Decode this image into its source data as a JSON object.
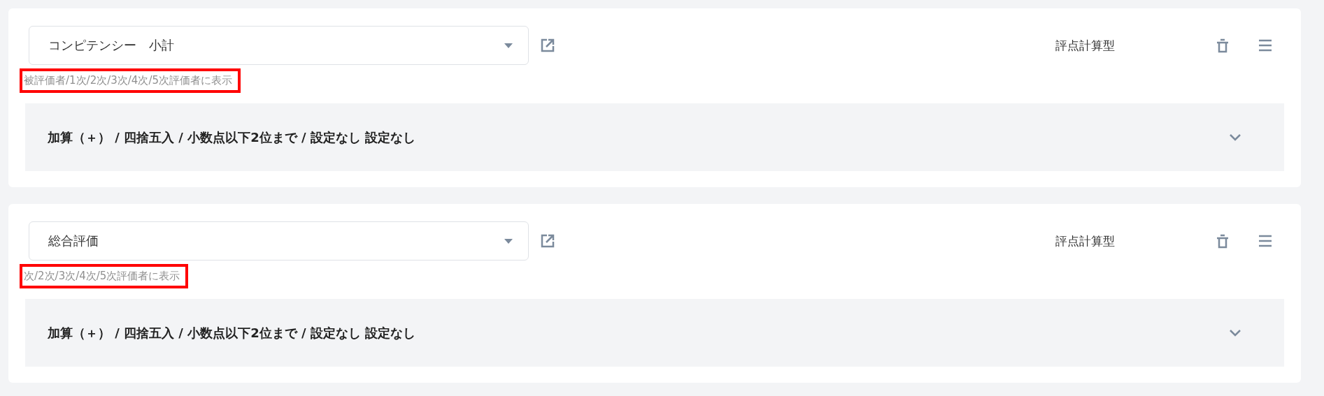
{
  "cards": [
    {
      "select": {
        "value": "コンピテンシー　小計"
      },
      "visibility_note": {
        "text": "被評価者/1次/2次/3次/4次/5次評価者に表示",
        "highlighted": true
      },
      "type_label": "評点計算型",
      "settings_panel": {
        "summary": "加算（＋） / 四捨五入 / 小数点以下2位まで / 設定なし 設定なし",
        "expanded": false
      }
    },
    {
      "select": {
        "value": "総合評価"
      },
      "visibility_note": {
        "text": "次/2次/3次/4次/5次評価者に表示",
        "highlighted": true
      },
      "type_label": "評点計算型",
      "settings_panel": {
        "summary": "加算（＋） / 四捨五入 / 小数点以下2位まで / 設定なし 設定なし",
        "expanded": false
      }
    }
  ]
}
